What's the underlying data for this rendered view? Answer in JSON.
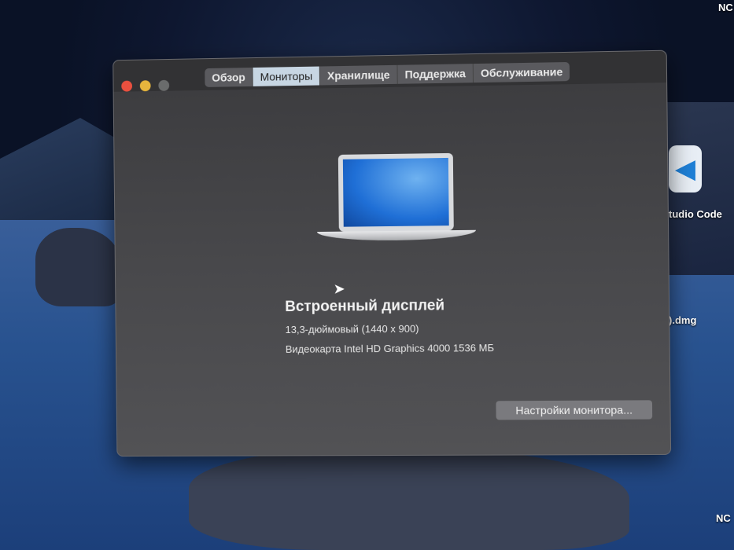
{
  "tabs": [
    "Обзор",
    "Мониторы",
    "Хранилище",
    "Поддержка",
    "Обслуживание"
  ],
  "active_tab": "Мониторы",
  "display": {
    "title": "Встроенный дисплей",
    "size": "13,3-дюймовый (1440 x 900)",
    "gpu": "Видеокарта Intel HD Graphics 4000 1536 МБ"
  },
  "button": "Настройки монитора...",
  "desktop": {
    "top_label": "NC",
    "vscode_label": "tudio Code",
    "dmg_label": ").dmg",
    "bottom_label": "NC"
  }
}
